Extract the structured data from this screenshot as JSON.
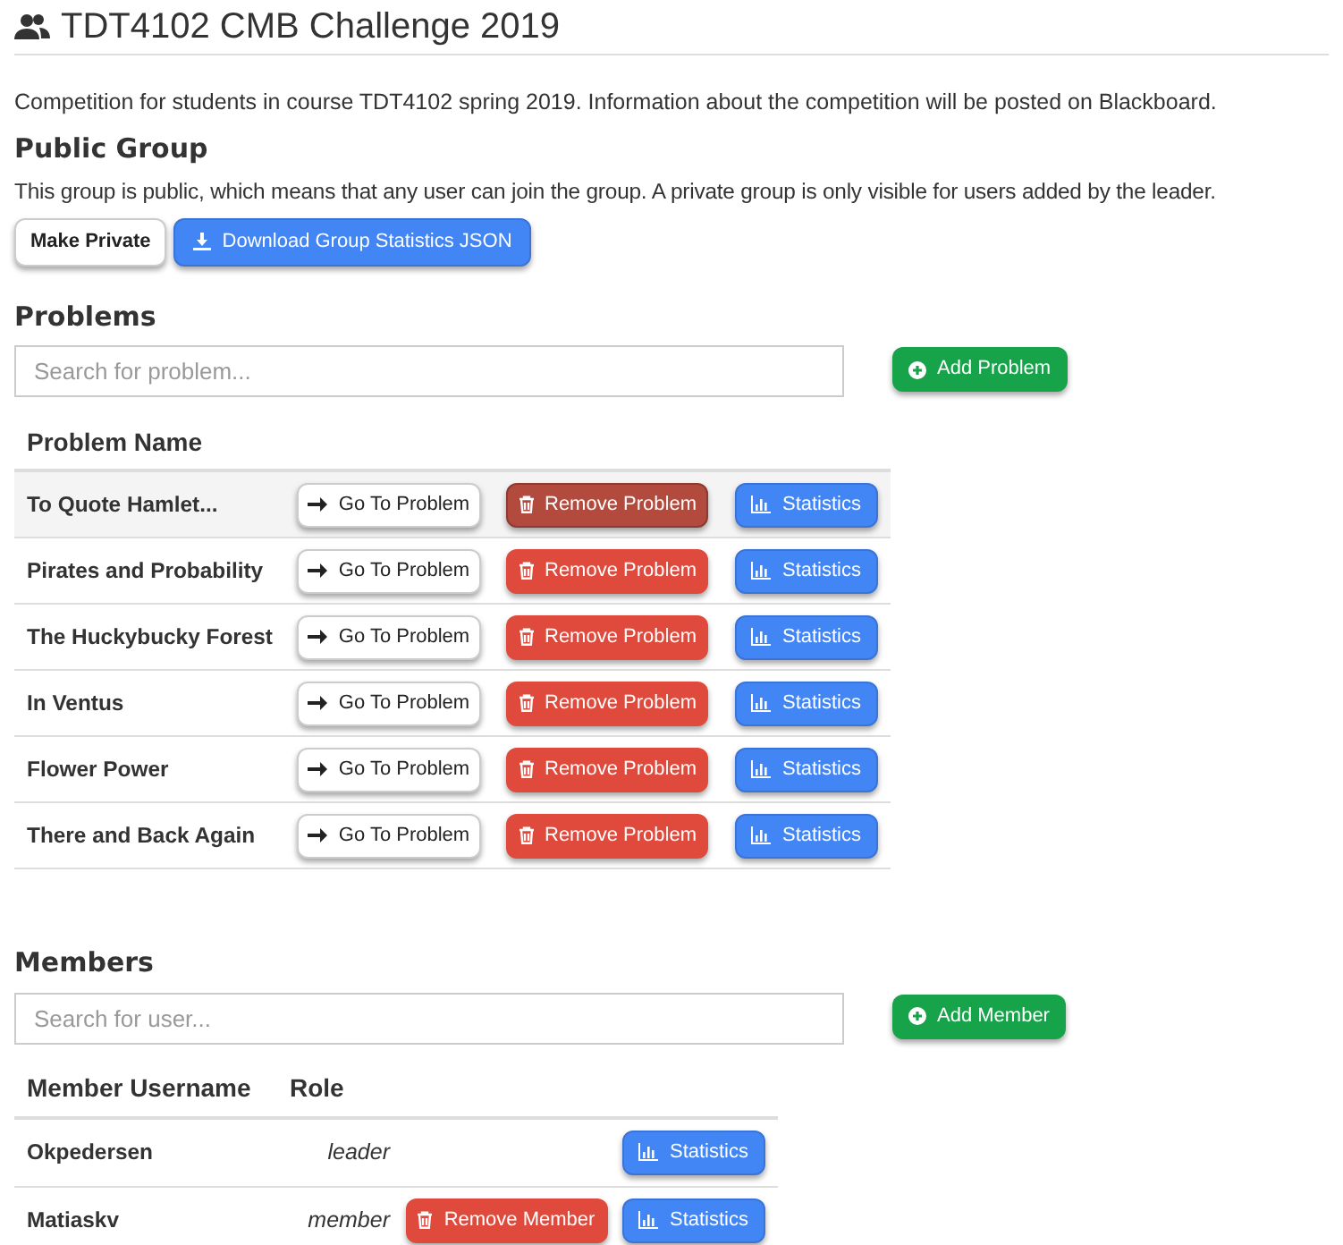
{
  "title": "TDT4102 CMB Challenge 2019",
  "description": "Competition for students in course TDT4102 spring 2019. Information about the competition will be posted on Blackboard.",
  "visibility": {
    "heading": "Public Group",
    "text": "This group is public, which means that any user can join the group. A private group is only visible for users added by the leader.",
    "buttons": [
      "Make Private",
      "Download Group Statistics JSON"
    ]
  },
  "problems": {
    "heading": "Problems",
    "search": {
      "placeholder": "Search for problem..."
    },
    "add_button": "Add Problem",
    "columns": [
      "Problem Name"
    ],
    "rows": [
      {
        "name": "To Quote Hamlet...",
        "highlighted": true,
        "go": "Go To Problem",
        "remove": "Remove Problem",
        "stats": "Statistics"
      },
      {
        "name": "Pirates and Probability",
        "highlighted": false,
        "go": "Go To Problem",
        "remove": "Remove Problem",
        "stats": "Statistics"
      },
      {
        "name": "The Huckybucky Forest",
        "highlighted": false,
        "go": "Go To Problem",
        "remove": "Remove Problem",
        "stats": "Statistics"
      },
      {
        "name": "In Ventus",
        "highlighted": false,
        "go": "Go To Problem",
        "remove": "Remove Problem",
        "stats": "Statistics"
      },
      {
        "name": "Flower Power",
        "highlighted": false,
        "go": "Go To Problem",
        "remove": "Remove Problem",
        "stats": "Statistics"
      },
      {
        "name": "There and Back Again",
        "highlighted": false,
        "go": "Go To Problem",
        "remove": "Remove Problem",
        "stats": "Statistics"
      }
    ]
  },
  "members": {
    "heading": "Members",
    "search": {
      "placeholder": "Search for user..."
    },
    "add_button": "Add Member",
    "columns": [
      "Member Username",
      "Role"
    ],
    "rows": [
      {
        "username": "Okpedersen",
        "role": "leader",
        "stats": "Statistics"
      },
      {
        "username": "Matiaskv",
        "role": "member",
        "remove": "Remove Member",
        "stats": "Statistics"
      }
    ]
  }
}
